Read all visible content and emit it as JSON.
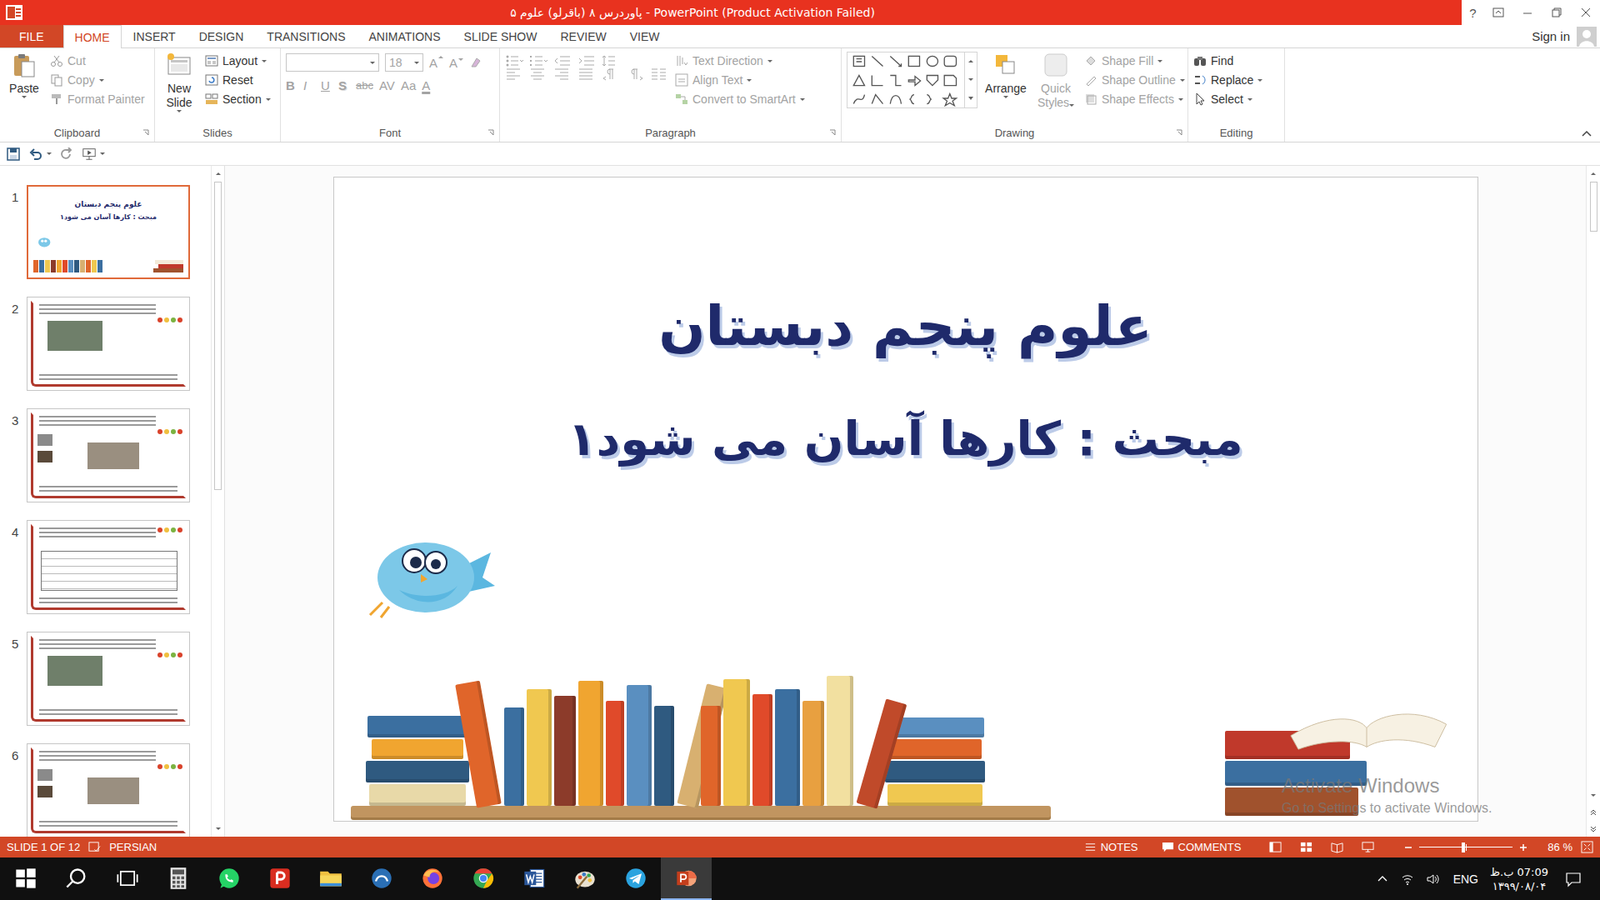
{
  "window": {
    "title": "پاوردرس ۸ (باقرلو) علوم ۵  -  PowerPoint (Product Activation Failed)",
    "help": "?"
  },
  "tabs": [
    {
      "label": "FILE",
      "kind": "file",
      "selected": false
    },
    {
      "label": "HOME",
      "kind": "tab",
      "selected": true
    },
    {
      "label": "INSERT",
      "kind": "tab",
      "selected": false
    },
    {
      "label": "DESIGN",
      "kind": "tab",
      "selected": false
    },
    {
      "label": "TRANSITIONS",
      "kind": "tab",
      "selected": false
    },
    {
      "label": "ANIMATIONS",
      "kind": "tab",
      "selected": false
    },
    {
      "label": "SLIDE SHOW",
      "kind": "tab",
      "selected": false
    },
    {
      "label": "REVIEW",
      "kind": "tab",
      "selected": false
    },
    {
      "label": "VIEW",
      "kind": "tab",
      "selected": false
    }
  ],
  "account": {
    "label": "Sign in"
  },
  "ribbon": {
    "clipboard": {
      "label": "Clipboard",
      "paste": {
        "label": "Paste",
        "disabled": false
      },
      "items": [
        {
          "label": "Cut",
          "disabled": true,
          "dropdown": false
        },
        {
          "label": "Copy",
          "disabled": true,
          "dropdown": true
        },
        {
          "label": "Format Painter",
          "disabled": true,
          "dropdown": false
        }
      ]
    },
    "slides": {
      "label": "Slides",
      "new_slide": [
        "New",
        "Slide"
      ],
      "items": [
        {
          "label": "Layout",
          "dropdown": true
        },
        {
          "label": "Reset",
          "dropdown": false
        },
        {
          "label": "Section",
          "dropdown": true
        }
      ]
    },
    "font": {
      "label": "Font",
      "name": "",
      "size": "18",
      "grow": "A",
      "shrink": "A",
      "disabled": true,
      "buttons": [
        "B",
        "I",
        "U",
        "S",
        "abc",
        "AV",
        "Aa",
        "A"
      ]
    },
    "paragraph": {
      "label": "Paragraph",
      "items": [
        {
          "label": "Text Direction",
          "disabled": true
        },
        {
          "label": "Align Text",
          "disabled": true
        },
        {
          "label": "Convert to SmartArt",
          "disabled": true
        }
      ]
    },
    "drawing": {
      "label": "Drawing",
      "arrange": {
        "label": "Arrange",
        "disabled": false
      },
      "quick_styles": {
        "lines": [
          "Quick",
          "Styles"
        ],
        "disabled": true
      },
      "items": [
        {
          "label": "Shape Fill",
          "disabled": true
        },
        {
          "label": "Shape Outline",
          "disabled": true
        },
        {
          "label": "Shape Effects",
          "disabled": true
        }
      ]
    },
    "editing": {
      "label": "Editing",
      "items": [
        {
          "label": "Find",
          "dropdown": false
        },
        {
          "label": "Replace",
          "dropdown": true
        },
        {
          "label": "Select",
          "dropdown": true
        }
      ]
    }
  },
  "slides": [
    {
      "number": "1",
      "selected": true,
      "kind": "title",
      "title": "علوم پنجم دبستان",
      "subtitle": "مبحث : کارها آسان می شود۱"
    },
    {
      "number": "2",
      "selected": false,
      "kind": "photo-left"
    },
    {
      "number": "3",
      "selected": false,
      "kind": "images"
    },
    {
      "number": "4",
      "selected": false,
      "kind": "table"
    },
    {
      "number": "5",
      "selected": false,
      "kind": "photo-left"
    },
    {
      "number": "6",
      "selected": false,
      "kind": "images"
    }
  ],
  "slide": {
    "title": "علوم پنجم دبستان",
    "subtitle": "مبحث : کارها آسان می شود۱"
  },
  "watermark": {
    "heading": "Activate Windows",
    "text": "Go to Settings to activate Windows."
  },
  "status_bar": {
    "slide": "SLIDE 1 OF 12",
    "language": "PERSIAN",
    "notes": "NOTES",
    "comments": "COMMENTS",
    "zoom": "86 %",
    "zoom_level": 0.47
  },
  "taskbar": {
    "apps": [
      {
        "kind": "start",
        "active": false
      },
      {
        "kind": "search",
        "active": false
      },
      {
        "kind": "task-view",
        "active": false
      },
      {
        "kind": "calculator",
        "active": false
      },
      {
        "kind": "whatsapp",
        "active": false
      },
      {
        "kind": "pdf",
        "active": false
      },
      {
        "kind": "explorer",
        "active": false
      },
      {
        "kind": "app",
        "active": false
      },
      {
        "kind": "firefox",
        "active": false
      },
      {
        "kind": "chrome",
        "active": false
      },
      {
        "kind": "word",
        "active": false
      },
      {
        "kind": "paint",
        "active": false
      },
      {
        "kind": "telegram",
        "active": false
      },
      {
        "kind": "powerpoint",
        "active": true
      }
    ],
    "language": "ENG",
    "time": "07:09 ب.ظ",
    "date": "۱۳۹۹/۰۸/۰۴"
  }
}
